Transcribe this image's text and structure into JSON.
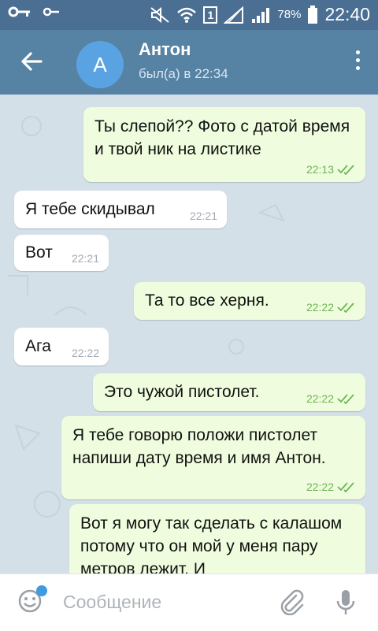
{
  "status_bar": {
    "battery": "78%",
    "time": "22:40",
    "sim": "1"
  },
  "header": {
    "avatar_letter": "А",
    "name": "Антон",
    "status": "был(а) в 22:34"
  },
  "messages": [
    {
      "dir": "out",
      "text": "Ты слепой??  Фото с датой время и твой ник на листике",
      "time": "22:13"
    },
    {
      "dir": "in",
      "text": "Я тебе скидывал",
      "time": "22:21"
    },
    {
      "dir": "in",
      "text": "Вот",
      "time": "22:21"
    },
    {
      "dir": "out",
      "text": "Та то все херня.",
      "time": "22:22"
    },
    {
      "dir": "in",
      "text": "Ага",
      "time": "22:22"
    },
    {
      "dir": "out",
      "text": "Это чужой пистолет.",
      "time": "22:22"
    },
    {
      "dir": "out",
      "text": "Я тебе говорю положи пистолет напиши дату время и имя Антон.",
      "time": "22:22"
    },
    {
      "dir": "out",
      "text": "Вот я могу так сделать с калашом потому что он мой у меня пару метров лежит. И",
      "time": ""
    }
  ],
  "input": {
    "placeholder": "Сообщение"
  },
  "colors": {
    "status_bar": "#4a6f93",
    "app_bar": "#5682a3",
    "avatar": "#5aa3e3",
    "outgoing_bubble": "#effdde",
    "incoming_bubble": "#ffffff",
    "check_marks": "#6cb552",
    "emoji_badge": "#3f9ae0"
  },
  "icons": [
    "key-icon",
    "key-icon",
    "mute-icon",
    "wifi-icon",
    "signal-icon",
    "battery-icon",
    "back-arrow-icon",
    "more-vert-icon",
    "double-check-icon",
    "emoji-icon",
    "attach-icon",
    "mic-icon"
  ]
}
